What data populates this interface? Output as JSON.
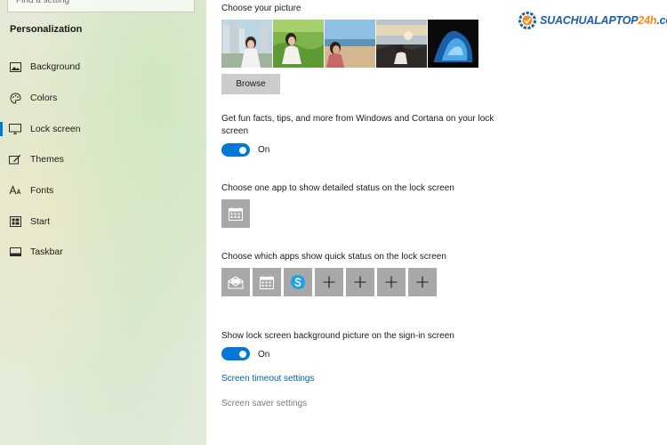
{
  "sidebar": {
    "search_placeholder": "Find a setting",
    "section_title": "Personalization",
    "items": [
      {
        "label": "Background",
        "icon": "picture-icon"
      },
      {
        "label": "Colors",
        "icon": "palette-icon"
      },
      {
        "label": "Lock screen",
        "icon": "monitor-icon",
        "active": true
      },
      {
        "label": "Themes",
        "icon": "brush-icon"
      },
      {
        "label": "Fonts",
        "icon": "font-icon"
      },
      {
        "label": "Start",
        "icon": "start-icon"
      },
      {
        "label": "Taskbar",
        "icon": "taskbar-icon"
      }
    ]
  },
  "main": {
    "choose_picture": "Choose your picture",
    "browse_label": "Browse",
    "fun_facts_line1": "Get fun facts, tips, and more from Windows and Cortana on your lock",
    "fun_facts_line2": "screen",
    "fun_facts_toggle": "On",
    "detailed_status": "Choose one app to show detailed status on the lock screen",
    "quick_status": "Choose which apps show quick status on the lock screen",
    "quick_status_apps": [
      "mail-icon",
      "calendar-icon",
      "skype-icon",
      "plus-icon",
      "plus-icon",
      "plus-icon",
      "plus-icon"
    ],
    "signin_bg": "Show lock screen background picture on the sign-in screen",
    "signin_toggle": "On",
    "timeout_link": "Screen timeout settings",
    "saver_link": "Screen saver settings"
  },
  "watermark": {
    "text_a": "SUACHUALAPTOP",
    "text_b": "24h",
    "text_c": ".com"
  },
  "colors": {
    "accent": "#0078d7",
    "link": "#0063b1",
    "tile": "#a8a8a8",
    "logo_blue": "#1a5fa8",
    "logo_orange": "#f28c1e"
  }
}
